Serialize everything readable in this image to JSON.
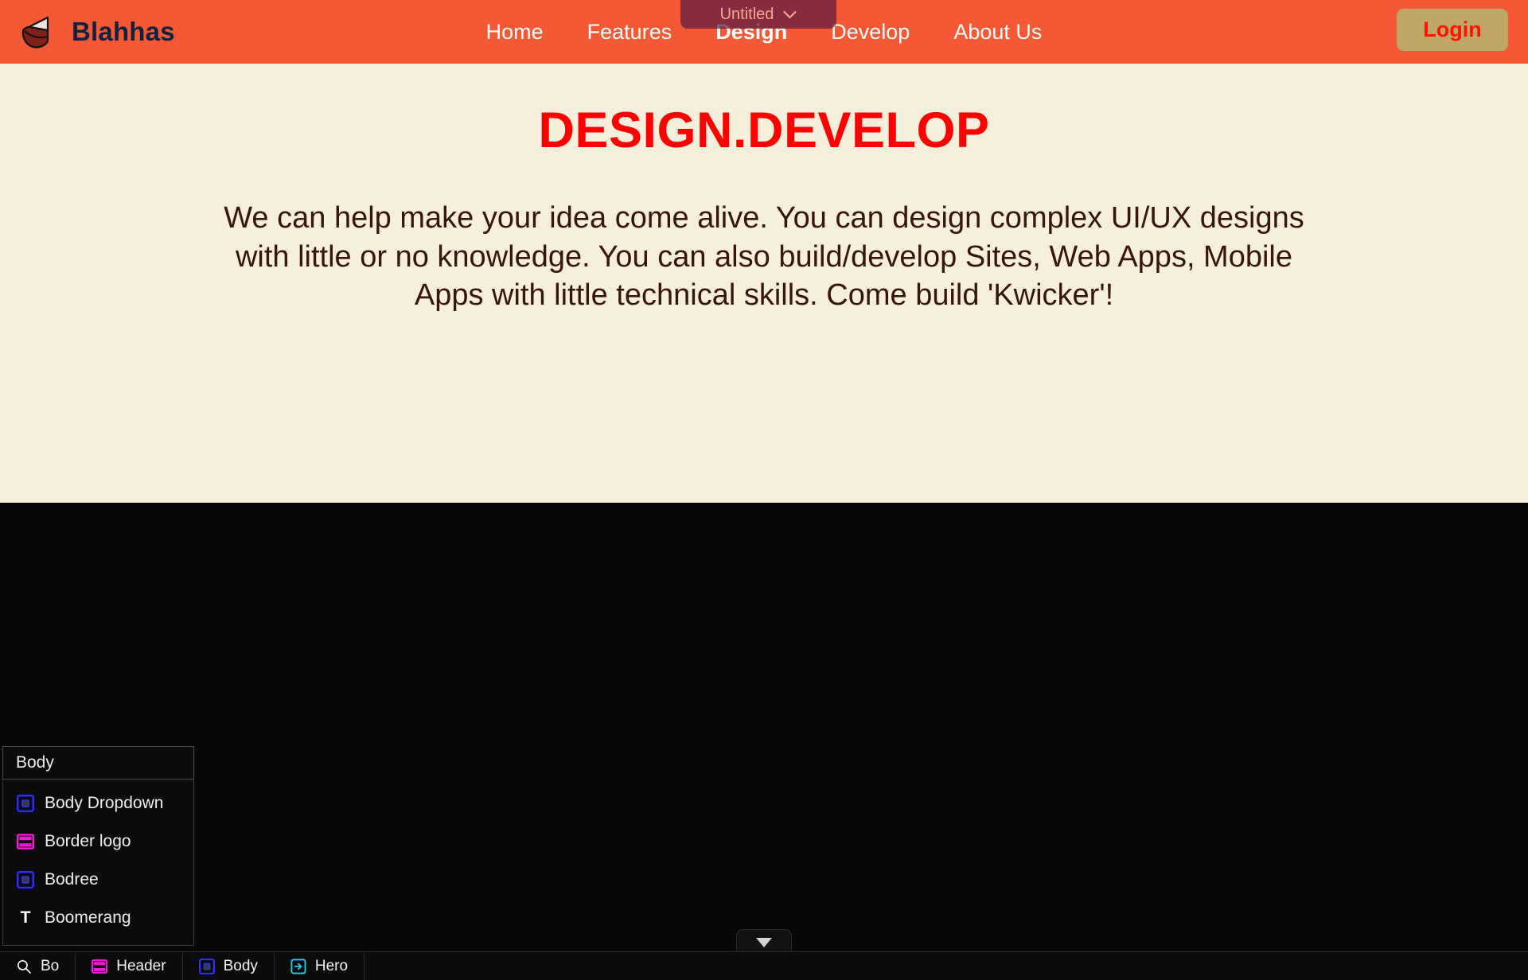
{
  "site": {
    "header": {
      "brand_name": "Blahhas",
      "logo_icon": "boat-sail-logo-icon",
      "background_color": "#F55834",
      "nav_items": [
        {
          "label": "Home",
          "active": false
        },
        {
          "label": "Features",
          "active": false
        },
        {
          "label": "Design",
          "active": true
        },
        {
          "label": "Develop",
          "active": false
        },
        {
          "label": "About Us",
          "active": false
        }
      ],
      "login_label": "Login",
      "login_bg_color": "#BFA867",
      "login_text_color": "#FF1200"
    },
    "selection_badge": {
      "label": "Untitled",
      "chevron_icon": "chevron-down-icon",
      "text_color": "#F8A793",
      "background_color": "#5C1C42"
    },
    "hero": {
      "title": "DESIGN.DEVELOP",
      "title_color": "#FF0000",
      "paragraph": "We can help make your idea come alive. You can design complex UI/UX designs with little or no knowledge. You can also build/develop Sites, Web Apps, Mobile Apps with little technical skills. Come build 'Kwicker'!",
      "paragraph_color": "#37150D",
      "background_color": "#F6EFDC"
    },
    "body_region": {
      "background_color": "#070707"
    }
  },
  "editor": {
    "collapse_tab": {
      "icon": "triangle-down-icon"
    },
    "autocomplete": {
      "input_value": "Body",
      "input_placeholder": "Body",
      "suggestions": [
        {
          "label": "Body Dropdown",
          "icon": "component-square-icon",
          "color": "#2F2FFF"
        },
        {
          "label": "Border logo",
          "icon": "header-block-icon",
          "color": "#F718D6"
        },
        {
          "label": "Bodree",
          "icon": "component-square-icon",
          "color": "#2F2FFF"
        },
        {
          "label": "Boomerang",
          "icon": "text-t-icon",
          "color": "#FFFFFF"
        }
      ]
    },
    "status_bar": {
      "search": {
        "icon": "search-icon",
        "value": "Bo"
      },
      "breadcrumb": [
        {
          "label": "Header",
          "icon": "header-block-icon",
          "color": "#F718D6"
        },
        {
          "label": "Body",
          "icon": "component-square-icon",
          "color": "#2F2FFF"
        },
        {
          "label": "Hero",
          "icon": "arrow-right-box-icon",
          "color": "#22D3EE"
        }
      ]
    }
  }
}
